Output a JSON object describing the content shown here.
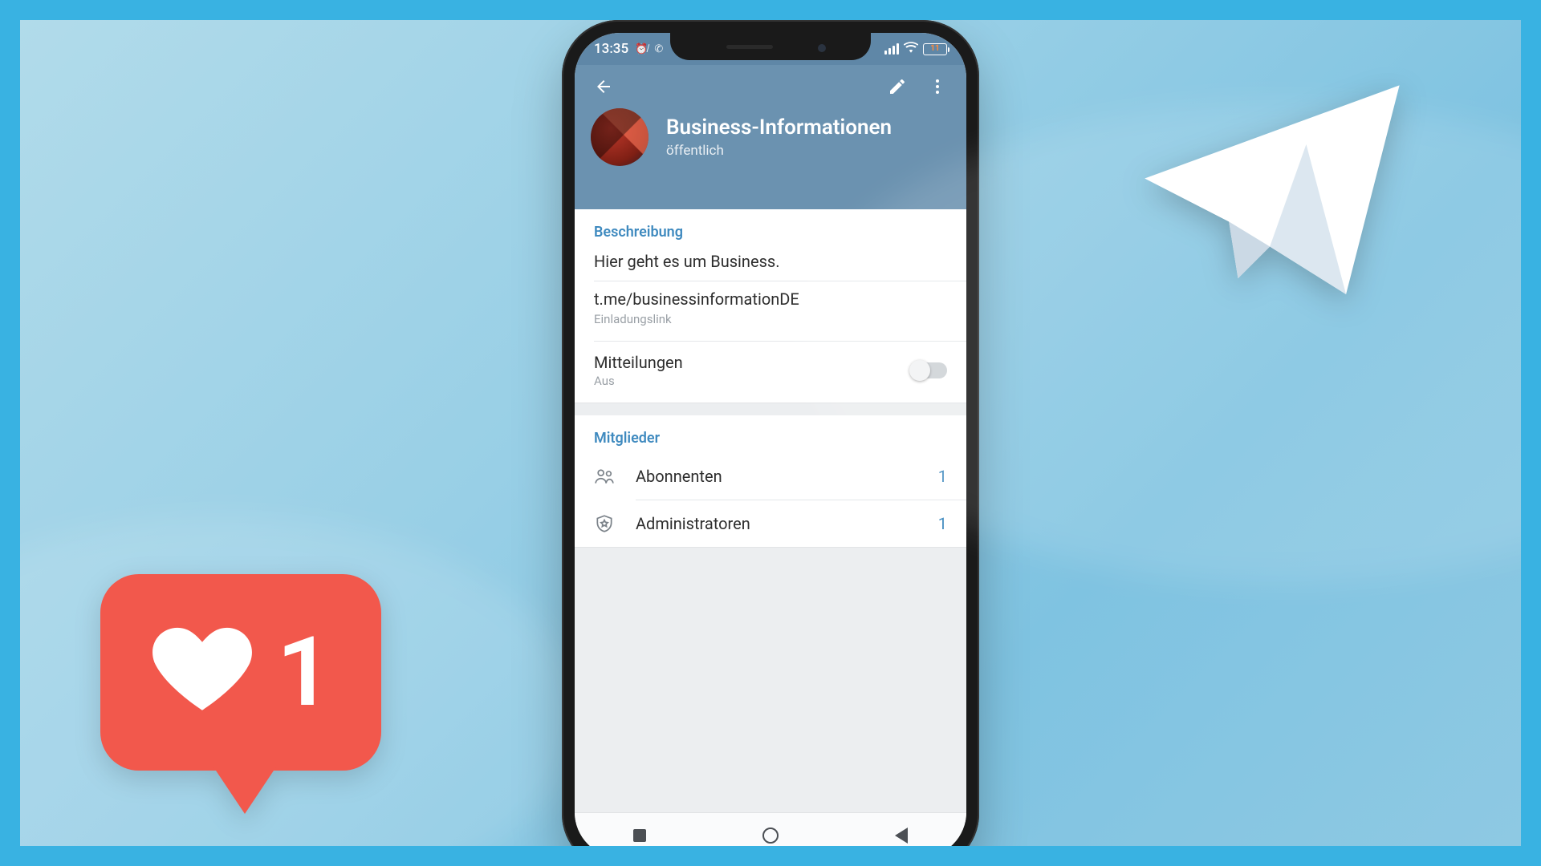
{
  "status_bar": {
    "time": "13:35",
    "battery_percent": "11"
  },
  "header": {
    "title": "Business-Informationen",
    "subtitle": "öffentlich"
  },
  "description": {
    "section_title": "Beschreibung",
    "text": "Hier geht es um Business.",
    "invite_link": "t.me/businessinformationDE",
    "invite_link_caption": "Einladungslink"
  },
  "notifications": {
    "label": "Mitteilungen",
    "state": "Aus",
    "enabled": false
  },
  "members": {
    "section_title": "Mitglieder",
    "rows": [
      {
        "label": "Abonnenten",
        "count": "1"
      },
      {
        "label": "Administratoren",
        "count": "1"
      }
    ]
  },
  "like_badge": {
    "count": "1"
  }
}
